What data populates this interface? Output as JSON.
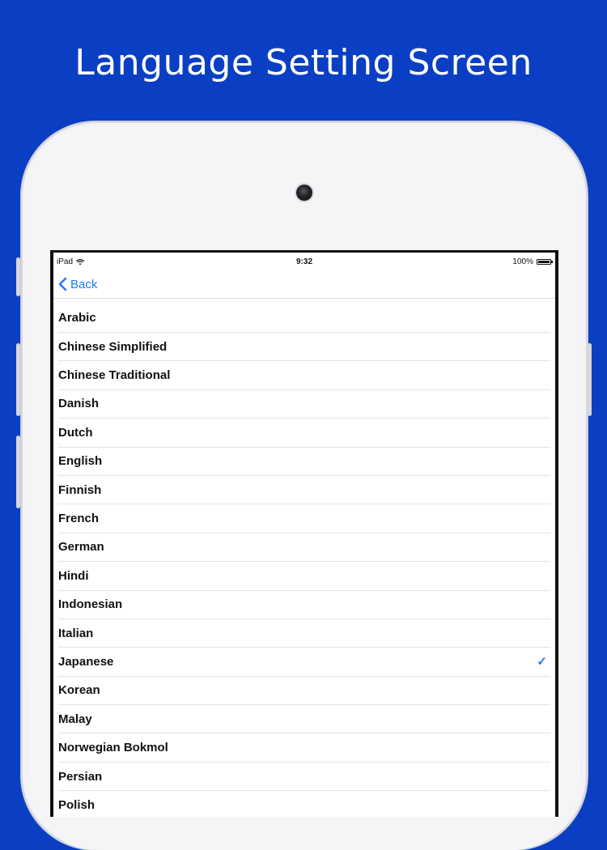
{
  "headline": "Language Setting Screen",
  "status_bar": {
    "device": "iPad",
    "time": "9:32",
    "battery": "100%"
  },
  "nav": {
    "back_label": "Back"
  },
  "accent_color": "#1c7cf2",
  "background_color": "#0a3fc4",
  "languages": [
    {
      "label": "Arabic",
      "selected": false
    },
    {
      "label": "Chinese Simplified",
      "selected": false
    },
    {
      "label": "Chinese Traditional",
      "selected": false
    },
    {
      "label": "Danish",
      "selected": false
    },
    {
      "label": "Dutch",
      "selected": false
    },
    {
      "label": "English",
      "selected": false
    },
    {
      "label": "Finnish",
      "selected": false
    },
    {
      "label": "French",
      "selected": false
    },
    {
      "label": "German",
      "selected": false
    },
    {
      "label": "Hindi",
      "selected": false
    },
    {
      "label": "Indonesian",
      "selected": false
    },
    {
      "label": "Italian",
      "selected": false
    },
    {
      "label": "Japanese",
      "selected": true
    },
    {
      "label": "Korean",
      "selected": false
    },
    {
      "label": "Malay",
      "selected": false
    },
    {
      "label": "Norwegian Bokmol",
      "selected": false
    },
    {
      "label": "Persian",
      "selected": false
    },
    {
      "label": "Polish",
      "selected": false
    }
  ]
}
